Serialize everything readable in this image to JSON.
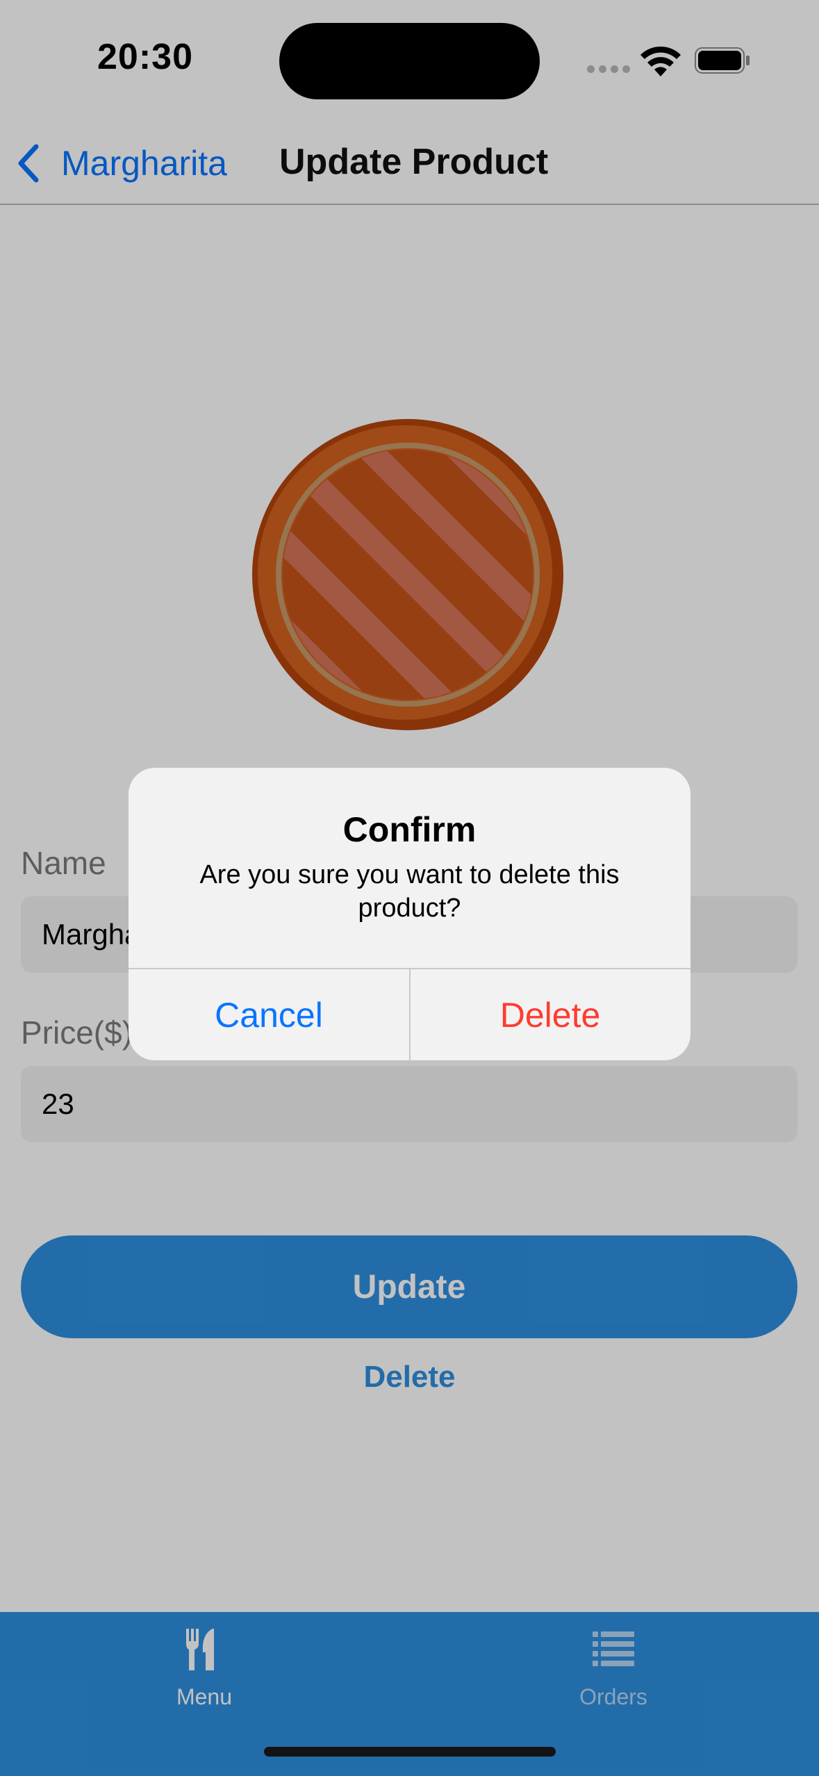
{
  "status_bar": {
    "time": "20:30"
  },
  "nav": {
    "back_label": "Margharita",
    "title": "Update Product"
  },
  "form": {
    "name_label": "Name",
    "name_value": "Margharita",
    "price_label": "Price($)",
    "price_value": "23",
    "update_label": "Update",
    "delete_label": "Delete"
  },
  "tabs": [
    {
      "label": "Menu",
      "icon": "fork-knife-icon",
      "active": true
    },
    {
      "label": "Orders",
      "icon": "list-icon",
      "active": false
    }
  ],
  "alert": {
    "title": "Confirm",
    "message": "Are you sure you want to delete this product?",
    "cancel_label": "Cancel",
    "confirm_label": "Delete"
  },
  "colors": {
    "accent": "#2e8fe0",
    "ios_blue": "#0a74ff",
    "destructive": "#ff3b30"
  }
}
